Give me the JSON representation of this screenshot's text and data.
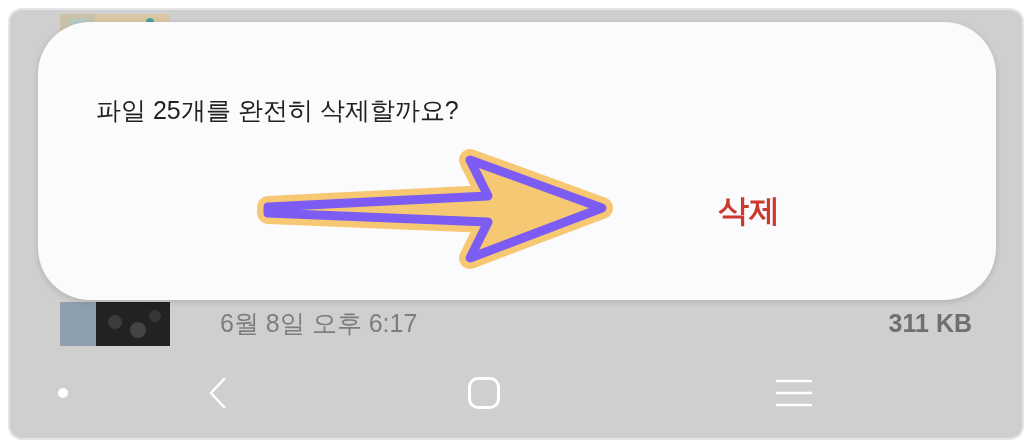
{
  "dialog": {
    "message": "파일 25개를 완전히 삭제할까요?",
    "buttons": [
      {
        "label": "삭제",
        "kind": "danger"
      }
    ]
  },
  "file_row": {
    "date": "6월 8일 오후 6:17",
    "size": "311 KB"
  }
}
